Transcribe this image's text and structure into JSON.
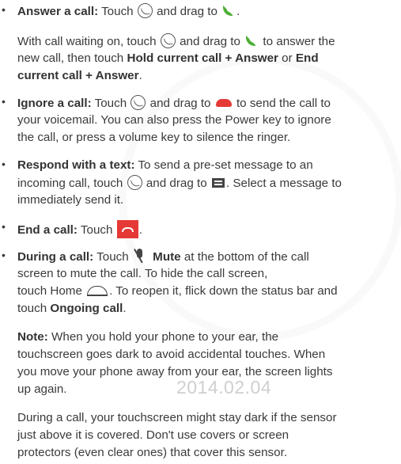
{
  "watermark": {
    "date": "2014.02.04"
  },
  "answer": {
    "bullet": "•",
    "label": "Answer a call:",
    "l1_a": "Touch",
    "l1_b": "and drag to",
    "l1_c": ".",
    "l2_a": "With call waiting on, touch",
    "l2_b": "and drag to",
    "l2_c": "to answer the",
    "l3_a": "new call, then touch",
    "l3_b": "Hold current call + Answer",
    "l3_c": "or",
    "l3_d": "End",
    "l4_a": "current call + Answer",
    "l4_b": "."
  },
  "ignore": {
    "bullet": "•",
    "label": "Ignore a call:",
    "l1_a": "Touch",
    "l1_b": "and drag to",
    "l1_c": "to send the call to",
    "l2": "your voicemail. You can also press the Power key to ignore",
    "l3": "the call, or press a volume key to silence the ringer."
  },
  "respond": {
    "bullet": "•",
    "label": "Respond with a text:",
    "l1_a": "To send a pre-set message to an",
    "l2_a": "incoming call, touch",
    "l2_b": "and drag to",
    "l2_c": ". Select a message to",
    "l3": "immediately send it."
  },
  "end": {
    "bullet": "•",
    "label": "End a call:",
    "l1_a": "Touch",
    "l1_b": "."
  },
  "during": {
    "bullet": "•",
    "label": "During a call:",
    "l1_a": "Touch",
    "l1_b": "Mute",
    "l1_c": "at the bottom of the call",
    "l2": "screen to mute the call. To hide the call screen,",
    "l3_a": "touch Home",
    "l3_b": ". To reopen it, flick down the status bar and",
    "l4_a": "touch",
    "l4_b": "Ongoing call",
    "l4_c": "."
  },
  "note": {
    "label": "Note:",
    "l1": "When you hold your phone to your ear, the",
    "l2": "touchscreen goes dark to avoid accidental touches. When",
    "l3": "you move your phone away from your ear, the screen lights",
    "l4": "up again."
  },
  "sensor": {
    "l1": "During a call, your touchscreen might stay dark if the sensor",
    "l2": "just above it is covered. Don't use covers or screen",
    "l3": "protectors (even clear ones) that cover this sensor."
  },
  "icons": {
    "call": "phone-call-circle-icon",
    "answer": "green-phone-icon",
    "ignore": "red-hangup-icon",
    "text": "message-icon",
    "end": "end-call-button-icon",
    "mute": "mute-mic-icon",
    "home": "home-icon"
  },
  "colors": {
    "green": "#4caf35",
    "red": "#e53935",
    "text": "#3a3a3a"
  }
}
